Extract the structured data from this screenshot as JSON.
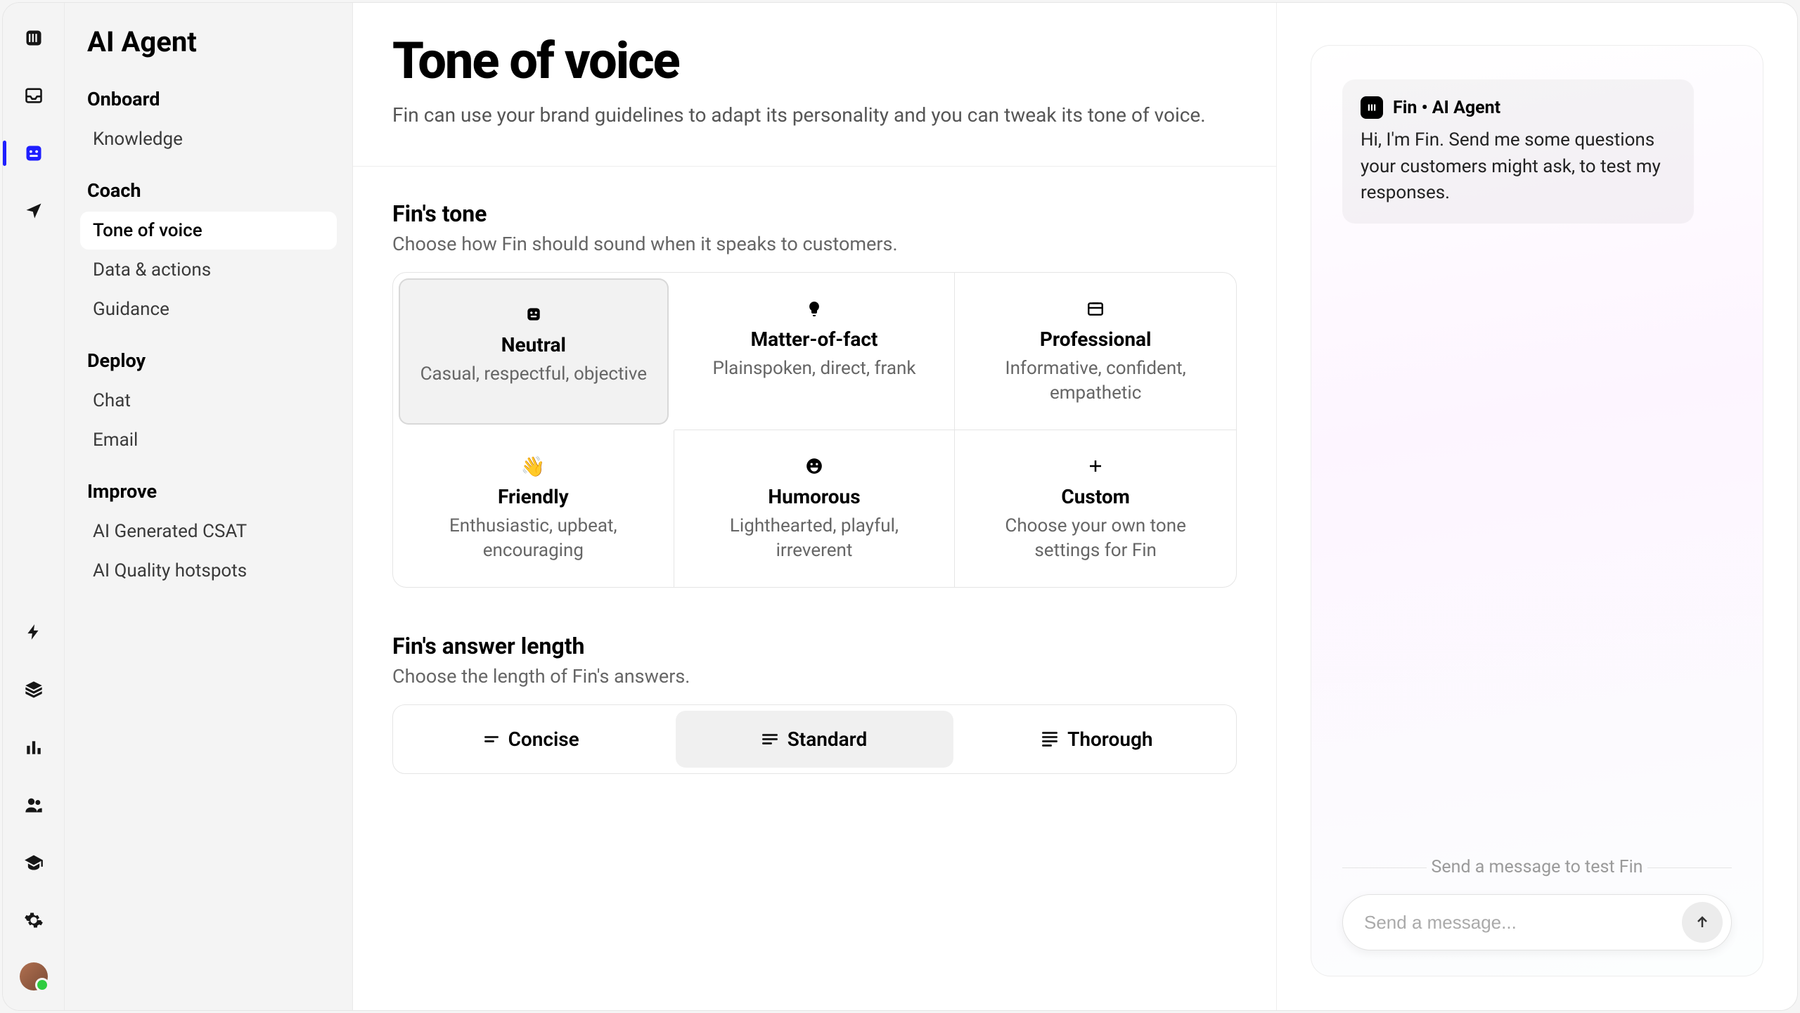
{
  "sidebarTitle": "AI Agent",
  "nav": {
    "sections": [
      {
        "title": "Onboard",
        "items": [
          {
            "label": "Knowledge",
            "selected": false
          }
        ]
      },
      {
        "title": "Coach",
        "items": [
          {
            "label": "Tone of voice",
            "selected": true
          },
          {
            "label": "Data & actions",
            "selected": false
          },
          {
            "label": "Guidance",
            "selected": false
          }
        ]
      },
      {
        "title": "Deploy",
        "items": [
          {
            "label": "Chat",
            "selected": false
          },
          {
            "label": "Email",
            "selected": false
          }
        ]
      },
      {
        "title": "Improve",
        "items": [
          {
            "label": "AI Generated CSAT",
            "selected": false
          },
          {
            "label": "AI Quality hotspots",
            "selected": false
          }
        ]
      }
    ]
  },
  "page": {
    "title": "Tone of voice",
    "subtitle": "Fin can use your brand guidelines to adapt its personality and you can tweak its tone of voice."
  },
  "finTone": {
    "title": "Fin's tone",
    "subtitle": "Choose how Fin should sound when it speaks to customers.",
    "options": [
      {
        "icon": "neutral-icon",
        "title": "Neutral",
        "desc": "Casual, respectful, objective",
        "selected": true
      },
      {
        "icon": "lightbulb-icon",
        "title": "Matter-of-fact",
        "desc": "Plainspoken, direct, frank",
        "selected": false
      },
      {
        "icon": "briefcase-icon",
        "title": "Professional",
        "desc": "Informative, confident, empathetic",
        "selected": false
      },
      {
        "icon": "wave-icon",
        "title": "Friendly",
        "desc": "Enthusiastic, upbeat, encouraging",
        "selected": false
      },
      {
        "icon": "laugh-icon",
        "title": "Humorous",
        "desc": "Lighthearted, playful, irreverent",
        "selected": false
      },
      {
        "icon": "plus-icon",
        "title": "Custom",
        "desc": "Choose your own tone settings for Fin",
        "selected": false
      }
    ]
  },
  "finLength": {
    "title": "Fin's answer length",
    "subtitle": "Choose the length of Fin's answers.",
    "options": [
      {
        "label": "Concise",
        "selected": false
      },
      {
        "label": "Standard",
        "selected": true
      },
      {
        "label": "Thorough",
        "selected": false
      }
    ]
  },
  "chat": {
    "agentName": "Fin • AI Agent",
    "welcome": "Hi, I'm Fin. Send me some questions your customers might ask, to test my responses.",
    "hint": "Send a message to test Fin",
    "placeholder": "Send a message..."
  }
}
